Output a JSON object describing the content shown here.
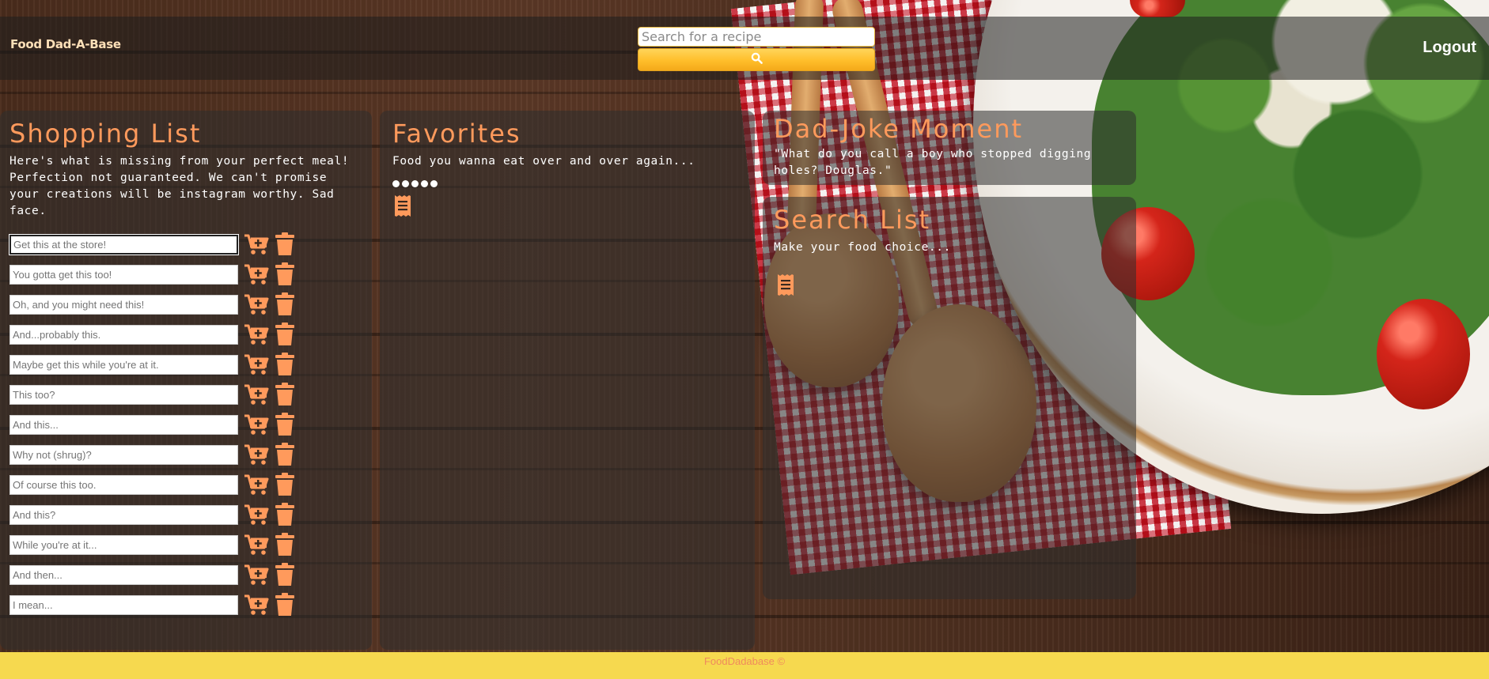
{
  "header": {
    "brand": "Food Dad-A-Base",
    "search_placeholder": "Search for a recipe",
    "search_icon": "search-icon",
    "logout_label": "Logout"
  },
  "shopping": {
    "title": "Shopping List",
    "subtitle": "Here's what is missing from your perfect meal! Perfection not guaranteed. We can't promise your creations will be instagram worthy. Sad face.",
    "items": [
      {
        "placeholder": "Get this at the store!"
      },
      {
        "placeholder": "You gotta get this too!"
      },
      {
        "placeholder": "Oh, and you might need this!"
      },
      {
        "placeholder": "And...probably this."
      },
      {
        "placeholder": "Maybe get this while you're at it."
      },
      {
        "placeholder": "This too?"
      },
      {
        "placeholder": "And this..."
      },
      {
        "placeholder": "Why not (shrug)?"
      },
      {
        "placeholder": "Of course this too."
      },
      {
        "placeholder": "And this?"
      },
      {
        "placeholder": "While you're at it..."
      },
      {
        "placeholder": "And then..."
      },
      {
        "placeholder": "I mean..."
      }
    ],
    "cart_icon": "add-to-cart-icon",
    "trash_icon": "trash-icon"
  },
  "favorites": {
    "title": "Favorites",
    "subtitle": "Food you wanna eat over and over again...",
    "icon": "receipt-icon"
  },
  "dadjoke": {
    "title": "Dad-Joke Moment",
    "text": "\"What do you call a boy who stopped digging holes? Douglas.\""
  },
  "searchlist": {
    "title": "Search List",
    "subtitle": "Make your food choice...",
    "icon": "receipt-icon"
  },
  "footer": {
    "text": "FoodDadabase ©"
  },
  "colors": {
    "accent": "#ff9a5c",
    "button_yellow": "#ffc02e",
    "footer_bg": "#f6d94f"
  }
}
